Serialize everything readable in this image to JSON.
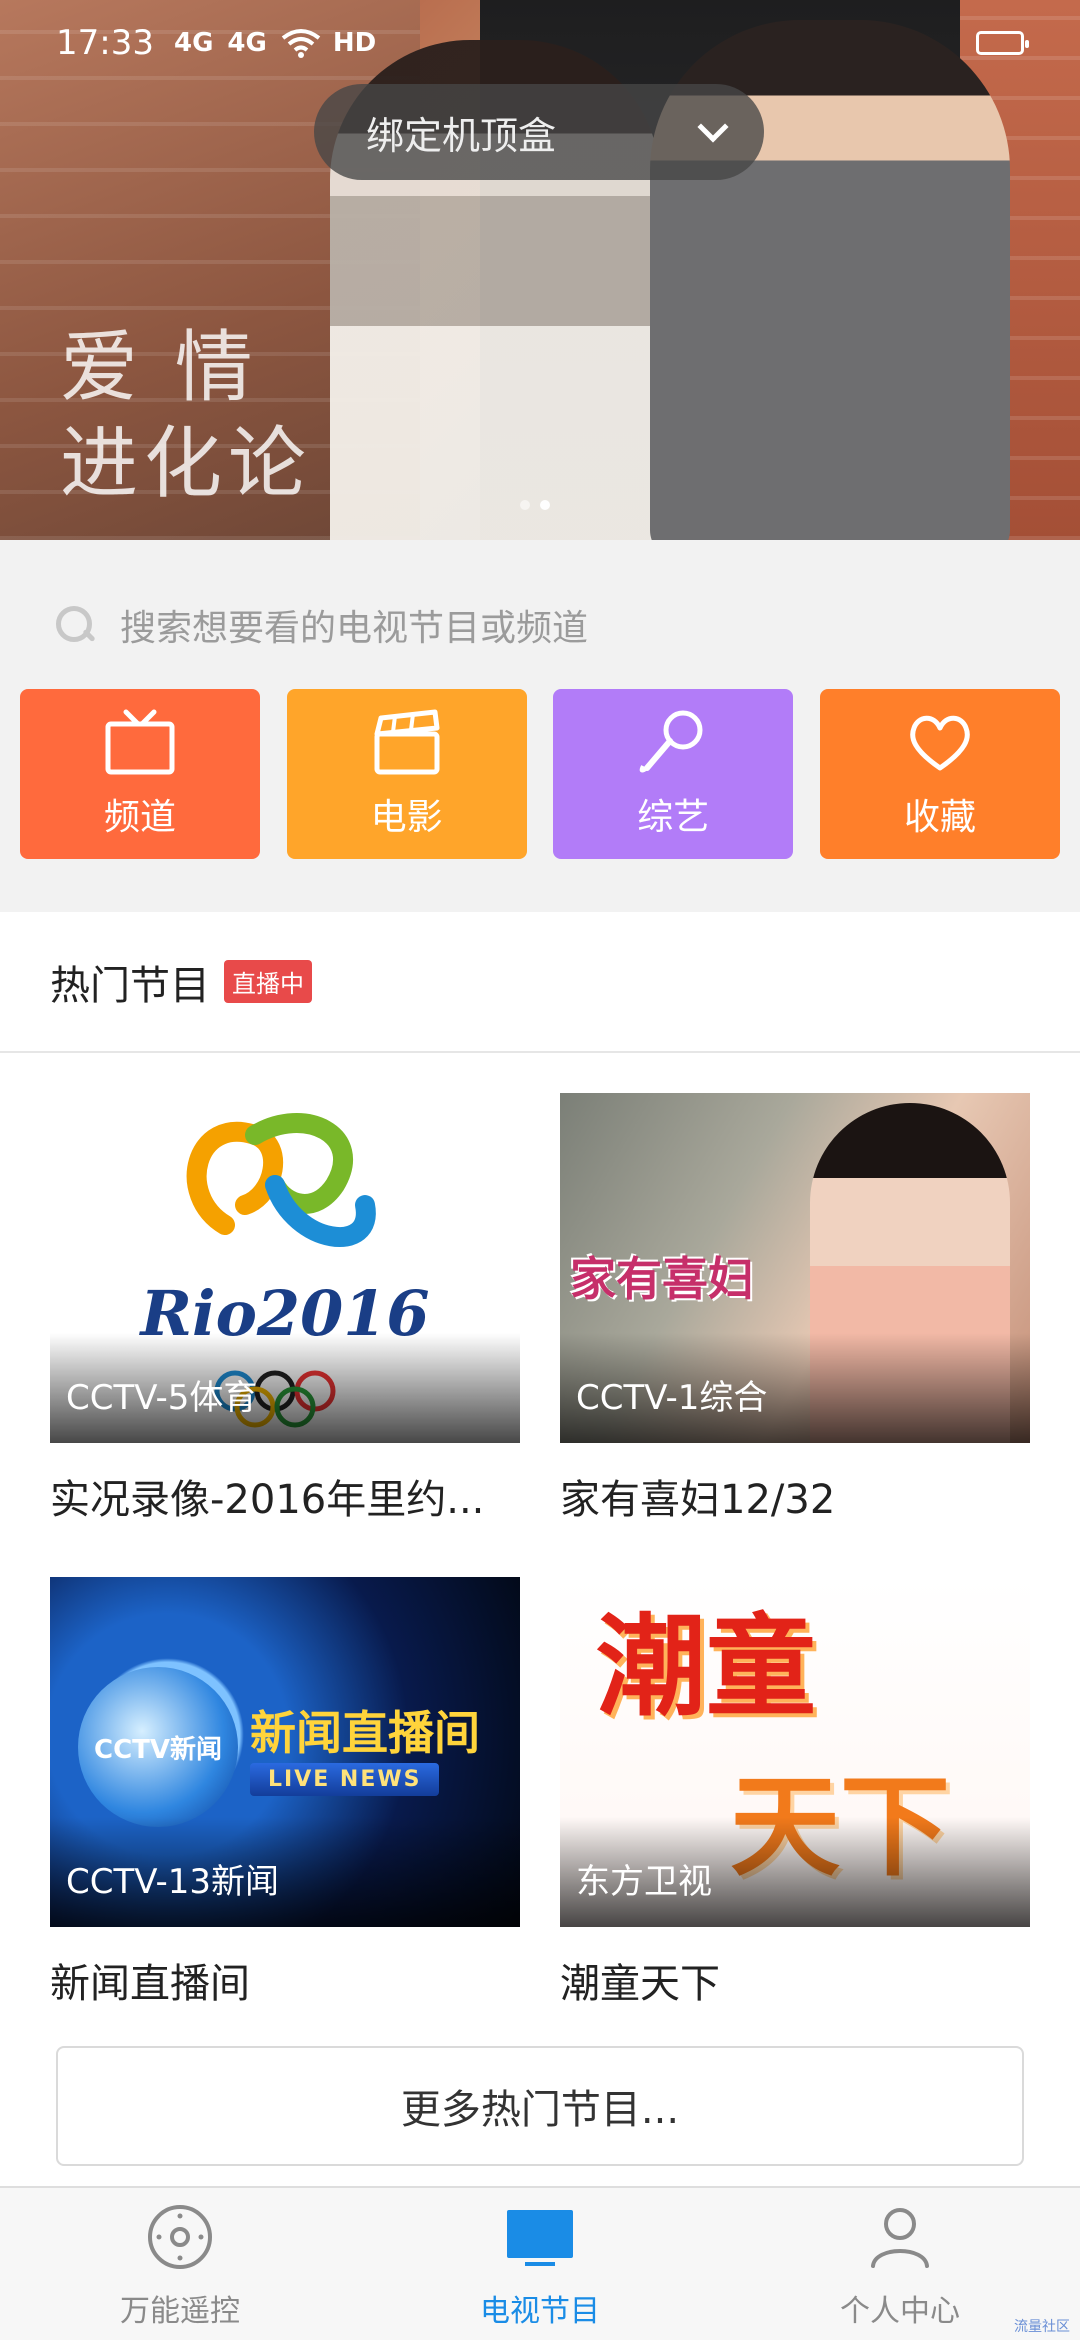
{
  "status_bar": {
    "time": "17:33",
    "signal1": "4G",
    "signal2": "4G",
    "hd": "HD"
  },
  "banner": {
    "bind_label": "绑定机顶盒",
    "promo_line1": "爱 情",
    "promo_line2": "进化论"
  },
  "search": {
    "placeholder": "搜索想要看的电视节目或频道"
  },
  "categories": [
    {
      "label": "频道",
      "color": "#ff6a3d",
      "icon": "tv-icon"
    },
    {
      "label": "电影",
      "color": "#ffa52a",
      "icon": "clapperboard-icon"
    },
    {
      "label": "综艺",
      "color": "#b27cf8",
      "icon": "microphone-icon"
    },
    {
      "label": "收藏",
      "color": "#ff7f2a",
      "icon": "heart-icon"
    }
  ],
  "hot": {
    "title": "热门节目",
    "badge": "直播中",
    "programs": [
      {
        "channel": "CCTV-5体育",
        "title": "实况录像-2016年里约..."
      },
      {
        "channel": "CCTV-1综合",
        "title": "家有喜妇12/32"
      },
      {
        "channel": "CCTV-13新闻",
        "title": "新闻直播间"
      },
      {
        "channel": "东方卫视",
        "title": "潮童天下"
      }
    ],
    "more_label": "更多热门节目..."
  },
  "thumbs": {
    "rio_word": "Rio2016",
    "drama_logo": "家有喜妇",
    "news_logo": "CCTV新闻",
    "news_text": "新闻直播间",
    "news_live": "LIVE NEWS",
    "kids_line1": "潮童",
    "kids_line2": "天下"
  },
  "bottom_nav": [
    {
      "label": "万能遥控",
      "icon": "remote-icon",
      "active": false
    },
    {
      "label": "电视节目",
      "icon": "tv-screen-icon",
      "active": true
    },
    {
      "label": "个人中心",
      "icon": "person-icon",
      "active": false
    }
  ],
  "watermark": "流量社区",
  "colors": {
    "accent": "#1a8ce6",
    "live_badge": "#e84a4a"
  }
}
